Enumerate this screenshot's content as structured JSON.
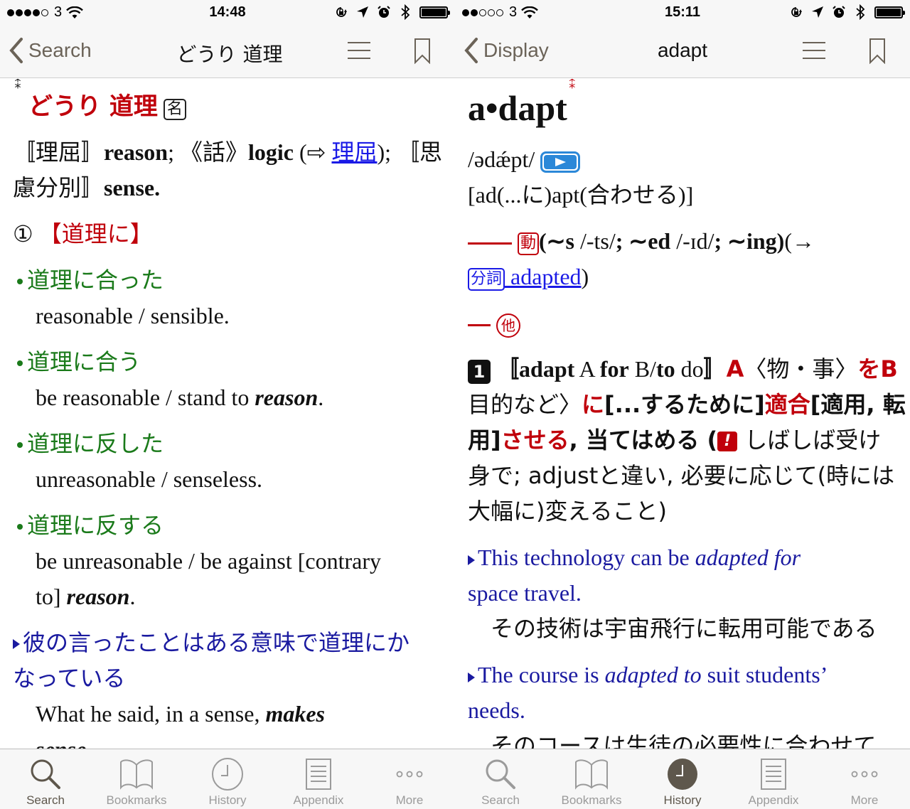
{
  "colors": {
    "headword_red": "#c0000b",
    "phrase_green": "#1a7a1a",
    "example_navy": "#1a1aa0",
    "link_blue": "#1a1ae6",
    "nav_brown": "#6b6358",
    "tab_active": "#5e574c",
    "tab_inactive": "#9b9b9b",
    "audio_blue": "#2b88d8"
  },
  "screens": [
    {
      "status": {
        "signal_bars": 4,
        "signal_total": 5,
        "carrier": "3",
        "time": "14:48",
        "icons": [
          "rotation-lock-icon",
          "location-icon",
          "alarm-icon",
          "bluetooth-icon",
          "battery-icon"
        ]
      },
      "nav": {
        "back_label": "Search",
        "title": "どうり 道理"
      },
      "entry": {
        "star": "⁑",
        "headword": "どうり 道理",
        "pos_tag": "名",
        "def_line1": {
          "b1": "〚理屈〛",
          "t1": "reason",
          "t1_sep": ";",
          "b2": "《話》",
          "t2": "logic",
          "paren_open": " (⇨ ",
          "xref": "理屈",
          "paren_close": "); ",
          "b3_start": "〚思"
        },
        "def_line2": {
          "b3_end": "慮分別〛",
          "t3": "sense."
        },
        "sense_num": "①",
        "sense_label": "【道理に】",
        "phrases": [
          {
            "jp": "道理に合った",
            "en_lines": [
              [
                {
                  "t": "reasonable / sensible.",
                  "s": ""
                }
              ]
            ]
          },
          {
            "jp": "道理に合う",
            "en_lines": [
              [
                {
                  "t": "be reasonable / stand to ",
                  "s": ""
                },
                {
                  "t": "reason",
                  "s": "bi"
                },
                {
                  "t": ".",
                  "s": ""
                }
              ]
            ]
          },
          {
            "jp": "道理に反した",
            "en_lines": [
              [
                {
                  "t": "unreasonable / senseless.",
                  "s": ""
                }
              ]
            ]
          },
          {
            "jp": "道理に反する",
            "en_lines": [
              [
                {
                  "t": "be unreasonable / be against [contrary",
                  "s": ""
                }
              ],
              [
                {
                  "t": "to] ",
                  "s": ""
                },
                {
                  "t": "reason",
                  "s": "bi"
                },
                {
                  "t": ".",
                  "s": ""
                }
              ]
            ]
          }
        ],
        "example": {
          "jp_line1": "彼の言ったことはある意味で道理にか",
          "jp_line2": "なっている",
          "en_line1_a": "What he said, in a sense, ",
          "en_line1_b": "makes",
          "en_line2": "sense."
        }
      },
      "tabs": [
        {
          "label": "Search",
          "icon": "search-icon",
          "active": true
        },
        {
          "label": "Bookmarks",
          "icon": "book-icon",
          "active": false
        },
        {
          "label": "History",
          "icon": "clock-icon",
          "active": false
        },
        {
          "label": "Appendix",
          "icon": "document-icon",
          "active": false
        },
        {
          "label": "More",
          "icon": "more-icon",
          "active": false
        }
      ]
    },
    {
      "status": {
        "signal_bars": 2,
        "signal_total": 5,
        "carrier": "3",
        "time": "15:11",
        "icons": [
          "rotation-lock-icon",
          "location-icon",
          "alarm-icon",
          "bluetooth-icon",
          "battery-icon"
        ]
      },
      "nav": {
        "back_label": "Display",
        "title": "adapt"
      },
      "entry": {
        "headword": "a•dapt",
        "star": "⁑",
        "pron": "/ədǽpt/",
        "etym": "[ad(...に)apt(合わせる)]",
        "verb_tag": "動",
        "inflections_a": "(∼s ",
        "infl_s_pron": "/-ts/",
        "inflections_b": "; ∼ed ",
        "infl_ed_pron": "/-ɪd/",
        "inflections_c": "; ∼ing)",
        "arrow": "(→",
        "participle_tag": "分詞",
        "participle_word": "adapted",
        "close_paren": ")",
        "transitive_tag": "他",
        "sense_num": "1",
        "pattern_open": "〚",
        "pattern_adapt": "adapt",
        "pattern_A": " A ",
        "pattern_for": "for",
        "pattern_B": " B/",
        "pattern_to": "to",
        "pattern_do": " do",
        "pattern_close": "〛",
        "def1": {
          "A": "A",
          "mono": "〈物・事〉",
          "wo": "を",
          "B": "B",
          "lt": "〈"
        },
        "def2": {
          "purpose": "目的など〉",
          "ni": "に",
          "suru": "[...するために]",
          "tekigo": "適合",
          "tekiyo": "[適用, 転"
        },
        "def3": {
          "yo": "用]",
          "saseru": "させる",
          "ateha": ", 当てはめる (",
          "note_icon": "!",
          "note_a": " しばしば受け"
        },
        "def4": "身で; adjustと違い, 必要に応じて(時には",
        "def5": "大幅に)変えること)",
        "examples": [
          {
            "en_a": "This technology can be ",
            "en_i": "adapted for",
            "en_b": "",
            "en_line2": "space travel.",
            "jp": "その技術は宇宙飛行に転用可能である"
          },
          {
            "en_a": "The course is ",
            "en_i": "adapted to",
            "en_b": " suit students’",
            "en_line2": "needs.",
            "jp": "そのコースは生徒の必要性に合わせて"
          }
        ]
      },
      "tabs": [
        {
          "label": "Search",
          "icon": "search-icon",
          "active": false
        },
        {
          "label": "Bookmarks",
          "icon": "book-icon",
          "active": false
        },
        {
          "label": "History",
          "icon": "clock-icon",
          "active": true
        },
        {
          "label": "Appendix",
          "icon": "document-icon",
          "active": false
        },
        {
          "label": "More",
          "icon": "more-icon",
          "active": false
        }
      ]
    }
  ]
}
